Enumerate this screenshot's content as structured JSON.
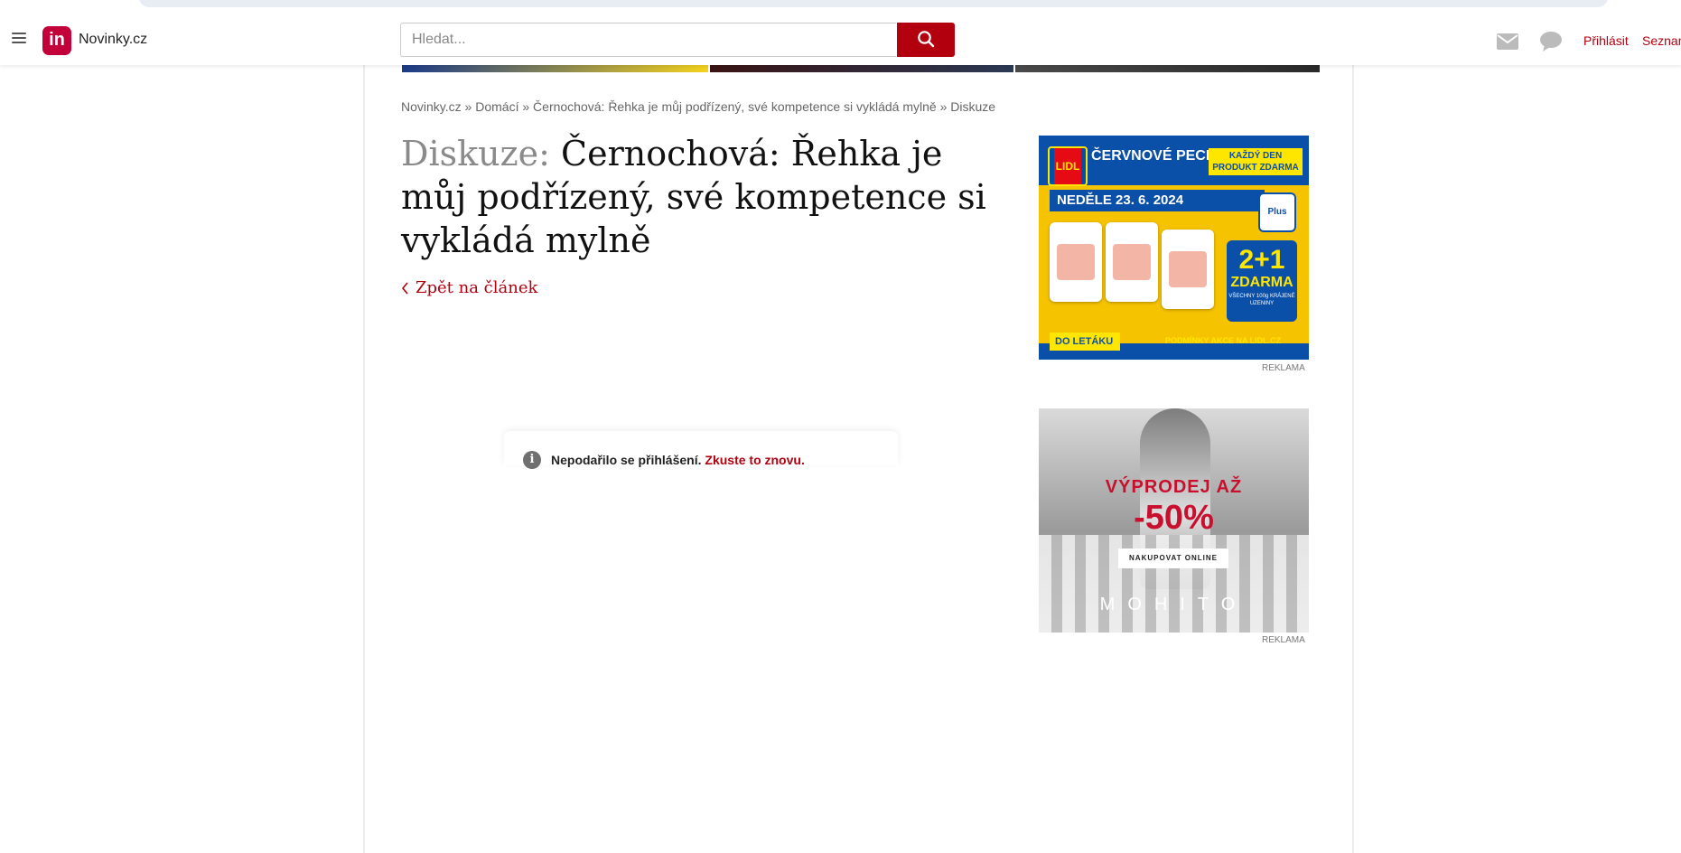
{
  "header": {
    "logo_mark": "in",
    "logo_text": "Novinky.cz",
    "search_placeholder": "Hledat...",
    "login": "Přihlásit",
    "seznam": "Seznam",
    "icons": [
      "menu-icon",
      "search-icon",
      "mail-icon",
      "chat-icon"
    ]
  },
  "breadcrumb": {
    "items": [
      "Novinky.cz",
      "Domácí",
      "Černochová: Řehka je můj podřízený, své kompetence si vykládá mylně",
      "Diskuze"
    ],
    "separator": "»"
  },
  "article": {
    "prefix": "Diskuze:",
    "title": "Černochová: Řehka je můj podřízený, své kompetence si vykládá mylně",
    "back_link": "Zpět na článek"
  },
  "notice": {
    "message": "Nepodařilo se přihlášení.",
    "retry": "Zkuste to znovu."
  },
  "ads": {
    "label": "REKLAMA",
    "lidl": {
      "brand": "LIDL",
      "headline": "ČERVNOVÉ PECKY",
      "badge": "KAŽDÝ DEN PRODUKT ZDARMA",
      "date": "NEDĚLE 23. 6. 2024",
      "plus": "Plus",
      "offer": "2+1",
      "offer_sub": "ZDARMA",
      "offer_note": "VŠECHNY 100g KRÁJENÉ UZENINY",
      "cta": "DO LETÁKU",
      "conditions": "PODMÍNKY AKCE NA LIDL.CZ"
    },
    "mohito": {
      "sale": "VÝPRODEJ AŽ",
      "percent": "-50%",
      "cta": "NAKUPOVAT ONLINE",
      "brand": "MOHITO"
    }
  },
  "colors": {
    "accent": "#b3000f",
    "logo": "#c2003a"
  }
}
